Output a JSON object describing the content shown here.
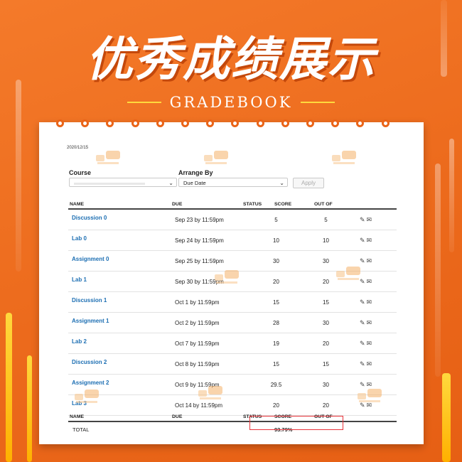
{
  "banner": {
    "title": "优秀成绩展示",
    "subtitle": "GRADEBOOK"
  },
  "gradebook": {
    "date": "2020/12/15",
    "course_label": "Course",
    "arrange_label": "Arrange By",
    "arrange_value": "Due Date",
    "apply_label": "Apply",
    "columns": {
      "name": "NAME",
      "due": "DUE",
      "status": "STATUS",
      "score": "SCORE",
      "out_of": "OUT OF"
    },
    "rows": [
      {
        "name": "Discussion 0",
        "due": "Sep 23 by 11:59pm",
        "score": "5",
        "out_of": "5"
      },
      {
        "name": "Lab 0",
        "due": "Sep 24 by 11:59pm",
        "score": "10",
        "out_of": "10"
      },
      {
        "name": "Assignment 0",
        "due": "Sep 25 by 11:59pm",
        "score": "30",
        "out_of": "30"
      },
      {
        "name": "Lab 1",
        "due": "Sep 30 by 11:59pm",
        "score": "20",
        "out_of": "20"
      },
      {
        "name": "Discussion 1",
        "due": "Oct 1 by 11:59pm",
        "score": "15",
        "out_of": "15"
      },
      {
        "name": "Assignment 1",
        "due": "Oct 2 by 11:59pm",
        "score": "28",
        "out_of": "30"
      },
      {
        "name": "Lab 2",
        "due": "Oct 7 by 11:59pm",
        "score": "19",
        "out_of": "20"
      },
      {
        "name": "Discussion 2",
        "due": "Oct 8 by 11:59pm",
        "score": "15",
        "out_of": "15"
      },
      {
        "name": "Assignment 2",
        "due": "Oct 9 by 11:59pm",
        "score": "29.5",
        "out_of": "30"
      },
      {
        "name": "Lab 3",
        "due": "Oct 14 by 11:59pm",
        "score": "20",
        "out_of": "20"
      }
    ],
    "total_label": "TOTAL",
    "total_value": "93.79%"
  },
  "colors": {
    "background": "#ec6a1c",
    "link": "#1d6fb3",
    "highlight": "#e8333a"
  }
}
